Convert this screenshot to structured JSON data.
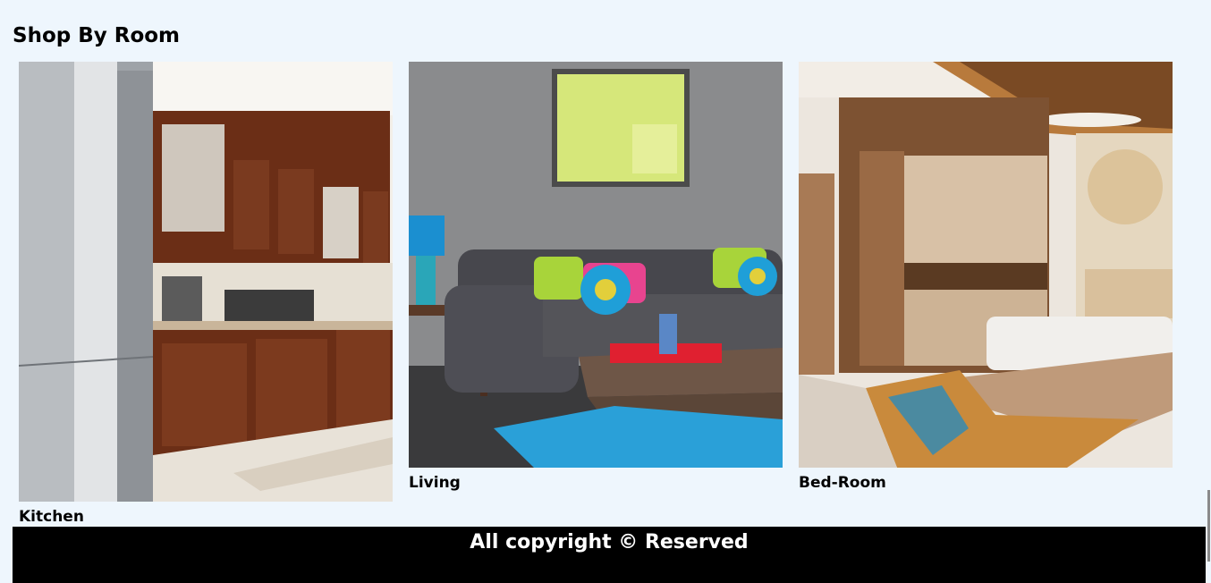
{
  "section": {
    "title": "Shop By Room"
  },
  "rooms": [
    {
      "label": "Kitchen"
    },
    {
      "label": "Living"
    },
    {
      "label": "Bed-Room"
    }
  ],
  "footer": {
    "text": "All copyright © Reserved"
  }
}
